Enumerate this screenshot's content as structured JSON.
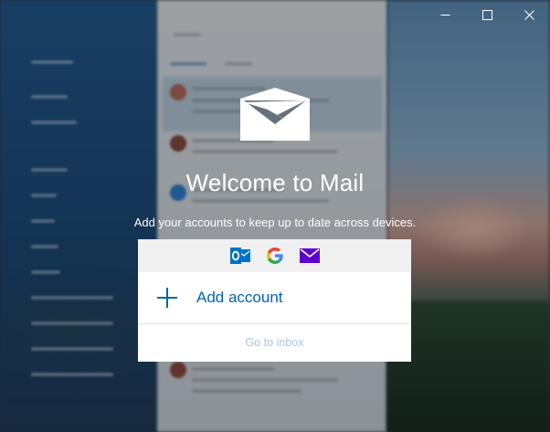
{
  "window": {
    "controls": [
      "minimize",
      "maximize",
      "close"
    ]
  },
  "welcome": {
    "title": "Welcome to Mail",
    "subtitle": "Add your accounts to keep up to date across devices.",
    "icon": "envelope-icon"
  },
  "providers": [
    {
      "name": "outlook",
      "icon": "outlook-icon",
      "color": "#0072c6"
    },
    {
      "name": "google",
      "icon": "google-icon",
      "color": "#4285f4"
    },
    {
      "name": "yahoo",
      "icon": "yahoo-mail-icon",
      "color": "#5f01d1"
    }
  ],
  "actions": {
    "add_account": "Add account",
    "go_to_inbox": "Go to inbox"
  },
  "colors": {
    "accent": "#0063b1",
    "link_muted": "#a9c6e4"
  }
}
